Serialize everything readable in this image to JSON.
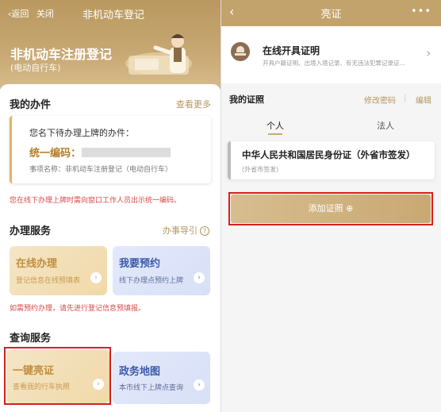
{
  "left": {
    "nav": {
      "back": "返回",
      "close": "关闭",
      "title": "非机动车登记"
    },
    "banner": {
      "title": "非机动车注册登记",
      "subtitle": "(电动自行车)"
    },
    "my_items": {
      "heading": "我的办件",
      "more": "查看更多",
      "pending_text": "您名下待办理上牌的办件：",
      "code_label": "统一编码：",
      "item_name": "事项名称：非机动车注册登记（电动自行车）"
    },
    "notice1": "您在线下办理上牌时需向窗口工作人员出示统一编码。",
    "services": {
      "heading": "办理服务",
      "guide": "办事导引",
      "tile1": {
        "title": "在线办理",
        "sub": "登记信息在线预填表"
      },
      "tile2": {
        "title": "我要预约",
        "sub": "线下办理点预约上牌"
      }
    },
    "notice2": "如需预约办理，请先进行登记信息预填报。",
    "query": {
      "heading": "查询服务",
      "tile1": {
        "title": "一键亮证",
        "sub": "查看我的行车执照"
      },
      "tile2": {
        "title": "政务地图",
        "sub": "本市线下上牌点查询"
      }
    }
  },
  "right": {
    "nav": {
      "title": "亮证",
      "menu": "•••"
    },
    "cert_service": {
      "title": "在线开具证明",
      "sub": "开具户籍证明、出境入境记录、有无违法犯罪记录证..."
    },
    "my_certs": {
      "heading": "我的证照",
      "change_pwd": "修改密码",
      "sep": "|",
      "edit": "编辑"
    },
    "tabs": {
      "personal": "个人",
      "corporate": "法人"
    },
    "id_card": {
      "title": "中华人民共和国居民身份证（外省市签发）",
      "sub": "(外省市签发)"
    },
    "add_button": "添加证照 ⊕"
  },
  "colors": {
    "gold": "#c3a36c",
    "red_highlight": "#d81e1e",
    "warning_text": "#d84a4a"
  }
}
